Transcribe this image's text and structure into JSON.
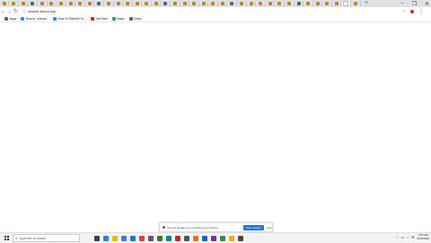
{
  "browser": {
    "tab_count": 38,
    "active_tab_index": 36,
    "new_tab_label": "+",
    "window_controls": [
      "–",
      "❐",
      "✕"
    ],
    "colors": {
      "tab_favicon": "#b58a1e",
      "tabstrip": "#dee1e6"
    },
    "toolbar": {
      "back_label": "←",
      "forward_label": "→",
      "reload_label": "↻",
      "url": "recycle.bin/ut.spy",
      "star_label": "☆",
      "menu_label": "⋮"
    },
    "bookmarks": [
      {
        "label": "Apps",
        "icon": "apps-grid-icon",
        "color": "#5f6368"
      },
      {
        "label": "How to..Videos...",
        "icon": "page-icon",
        "color": "#4285f4"
      },
      {
        "label": "How To Rebuild Yo...",
        "icon": "page-icon",
        "color": "#4285f4"
      },
      {
        "label": "YouTube",
        "icon": "youtube-icon",
        "color": "#e62117"
      },
      {
        "label": "Maps",
        "icon": "maps-icon",
        "color": "#34a853"
      },
      {
        "label": "Video",
        "icon": "video-icon",
        "color": "#5f6368"
      }
    ]
  },
  "notification": {
    "text": "chrome.google.com is sharing your screen",
    "primary_button": "Stop sharing",
    "secondary_button": "Hide"
  },
  "taskbar": {
    "search_placeholder": "Type here to search",
    "apps": [
      {
        "name": "task-view-icon",
        "color": "#404040"
      },
      {
        "name": "edge-icon",
        "color": "#1e88e5"
      },
      {
        "name": "file-explorer-icon",
        "color": "#f2b705"
      },
      {
        "name": "store-icon",
        "color": "#3d7ac7"
      },
      {
        "name": "mail-icon",
        "color": "#0078d7"
      },
      {
        "name": "chrome-icon",
        "color": "#db4437"
      },
      {
        "name": "app-icon",
        "color": "#6a4c93"
      },
      {
        "name": "app-icon",
        "color": "#2e7d32"
      },
      {
        "name": "app-icon",
        "color": "#00897b"
      },
      {
        "name": "app-icon",
        "color": "#c62828"
      },
      {
        "name": "app-icon",
        "color": "#455a64"
      },
      {
        "name": "app-icon",
        "color": "#ef6c00"
      },
      {
        "name": "app-icon",
        "color": "#1565c0"
      },
      {
        "name": "app-icon",
        "color": "#8e24aa"
      },
      {
        "name": "app-icon",
        "color": "#388e3c"
      },
      {
        "name": "app-icon",
        "color": "#f9a825"
      },
      {
        "name": "app-icon",
        "color": "#5d4037"
      }
    ],
    "tray_icons": [
      "^",
      "▭",
      "♪",
      "✉"
    ],
    "time": "3:57 AM",
    "date": "8/15/2020"
  }
}
